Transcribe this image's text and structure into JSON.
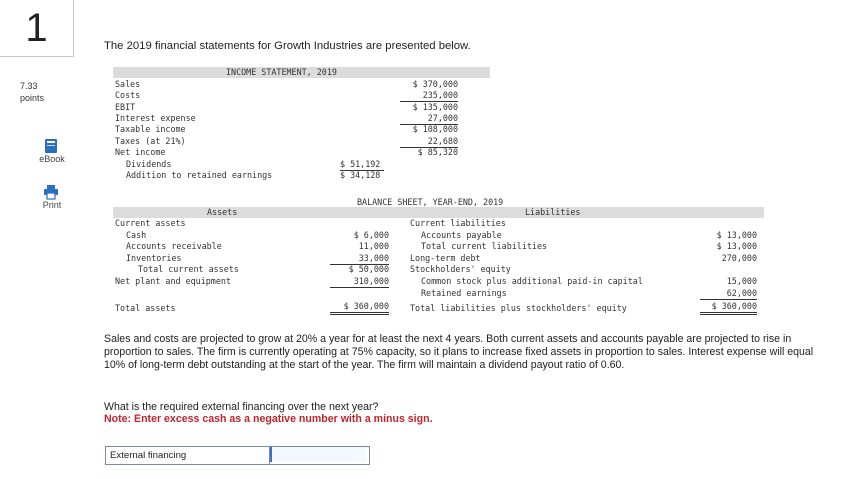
{
  "question": {
    "number": "1",
    "points_value": "7.33",
    "points_label": "points",
    "intro": "The 2019 financial statements for Growth Industries are presented below."
  },
  "sidebar": {
    "ebook_label": "eBook",
    "print_label": "Print"
  },
  "income_statement": {
    "title": "INCOME STATEMENT, 2019",
    "rows": [
      {
        "label": "Sales",
        "value": "$ 370,000"
      },
      {
        "label": "Costs",
        "value": "235,000"
      },
      {
        "label": "EBIT",
        "value": "$ 135,000"
      },
      {
        "label": "Interest expense",
        "value": "27,000"
      },
      {
        "label": "Taxable income",
        "value": "$ 108,000"
      },
      {
        "label": "Taxes (at 21%)",
        "value": "22,680"
      },
      {
        "label": "Net income",
        "value": "$ 85,320"
      },
      {
        "label": "Dividends",
        "value": "$ 51,192"
      },
      {
        "label": "Addition to retained earnings",
        "value": "$ 34,128"
      }
    ]
  },
  "balance_sheet": {
    "title": "BALANCE SHEET, YEAR-END, 2019",
    "assets_header": "Assets",
    "liabilities_header": "Liabilities",
    "assets": [
      {
        "label": "Current assets",
        "value": ""
      },
      {
        "label": "Cash",
        "value": "$ 6,000"
      },
      {
        "label": "Accounts receivable",
        "value": "11,000"
      },
      {
        "label": "Inventories",
        "value": "33,000"
      },
      {
        "label": "Total current assets",
        "value": "$ 50,000"
      },
      {
        "label": "Net plant and equipment",
        "value": "310,000"
      },
      {
        "label": "Total assets",
        "value": "$ 360,000"
      }
    ],
    "liabilities": [
      {
        "label": "Current liabilities",
        "value": ""
      },
      {
        "label": "Accounts payable",
        "value": "$ 13,000"
      },
      {
        "label": "Total current liabilities",
        "value": "$ 13,000"
      },
      {
        "label": "Long-term debt",
        "value": "270,000"
      },
      {
        "label": "Stockholders' equity",
        "value": ""
      },
      {
        "label": "Common stock plus additional paid-in capital",
        "value": "15,000"
      },
      {
        "label": "Retained earnings",
        "value": "62,000"
      },
      {
        "label": "Total liabilities plus stockholders' equity",
        "value": "$ 360,000"
      }
    ]
  },
  "paragraph": "Sales and costs are projected to grow at 20% a year for at least the next 4 years. Both current assets and accounts payable are projected to rise in proportion to sales. The firm is currently operating at 75% capacity, so it plans to increase fixed assets in proportion to sales. Interest expense will equal 10% of long-term debt outstanding at the start of the year. The firm will maintain a dividend payout ratio of 0.60.",
  "prompt": "What is the required external financing over the next year?",
  "note": "Note: Enter excess cash as a negative number with a minus sign.",
  "answer": {
    "label": "External financing",
    "value": ""
  }
}
